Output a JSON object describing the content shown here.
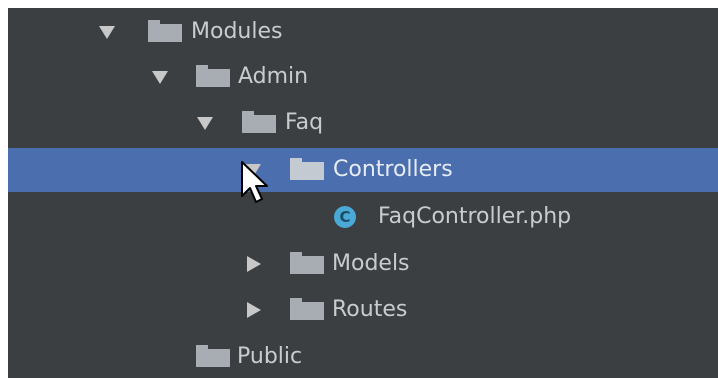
{
  "tree": {
    "items": [
      {
        "label": "Modules",
        "expanded": true,
        "icon": "folder-icon"
      },
      {
        "label": "Admin",
        "expanded": true,
        "icon": "folder-icon"
      },
      {
        "label": "Faq",
        "expanded": true,
        "icon": "folder-icon"
      },
      {
        "label": "Controllers",
        "expanded": true,
        "selected": true,
        "icon": "folder-icon"
      },
      {
        "label": "FaqController.php",
        "icon": "php-class-icon",
        "icon_glyph": "C"
      },
      {
        "label": "Models",
        "expanded": false,
        "icon": "folder-icon"
      },
      {
        "label": "Routes",
        "expanded": false,
        "icon": "folder-icon"
      },
      {
        "label": "Public",
        "icon": "folder-icon"
      }
    ]
  },
  "colors": {
    "panel_bg": "#3c3f41",
    "selection": "#4b6eaf",
    "text": "#c9ccce",
    "folder": "#a7adb2",
    "class_icon": "#4aa9d6"
  },
  "cursor": {
    "icon": "mouse-pointer-icon"
  }
}
